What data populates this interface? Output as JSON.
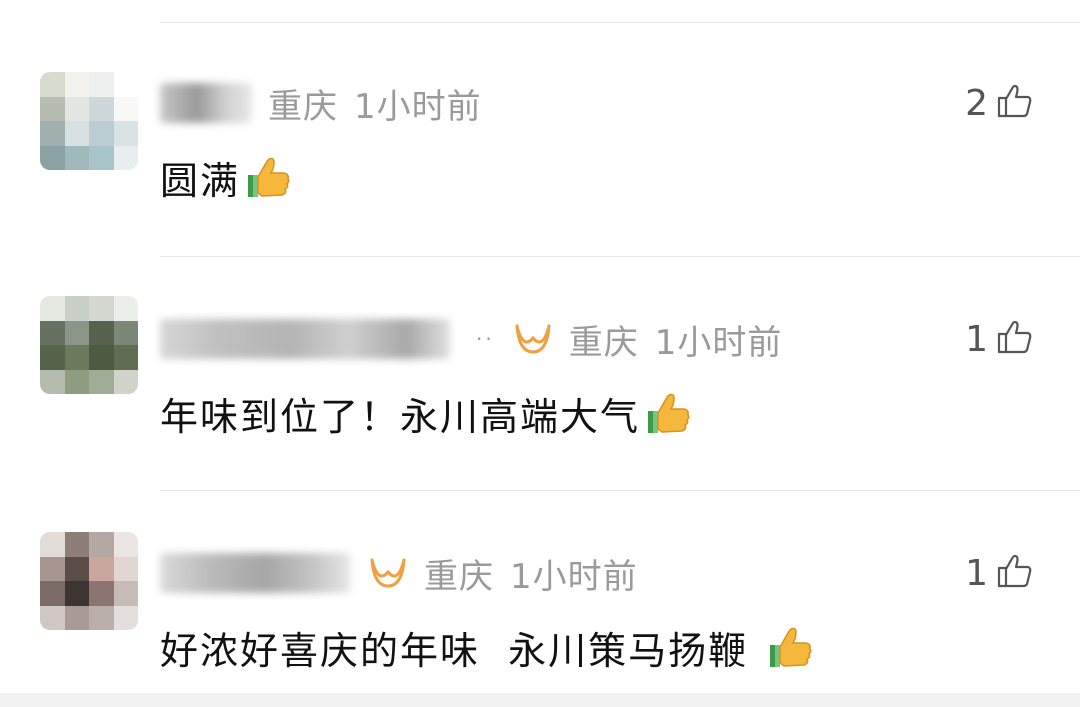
{
  "comments": [
    {
      "location": "重庆",
      "time": "1小时前",
      "text": "圆满",
      "likes": "2",
      "has_vip_badge": false
    },
    {
      "location": "重庆",
      "time": "1小时前",
      "text": "年味到位了！永川高端大气",
      "likes": "1",
      "has_vip_badge": true
    },
    {
      "location": "重庆",
      "time": "1小时前",
      "text": "好浓好喜庆的年味  永川策马扬鞭 ",
      "likes": "1",
      "has_vip_badge": true
    }
  ],
  "icons": {
    "like": "thumbs-up-outline-icon",
    "emoji": "thumbs-up-emoji-icon",
    "vip": "vip-badge-icon"
  },
  "colors": {
    "meta_text": "#9a9a9a",
    "comment_text": "#111111",
    "vip_badge": "#f0a040",
    "divider": "#e6e6e6"
  }
}
